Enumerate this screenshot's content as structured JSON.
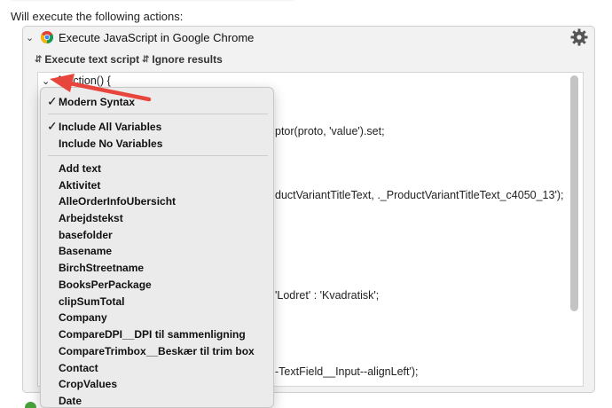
{
  "header": {
    "text": "Will execute the following actions:"
  },
  "action": {
    "title": "Execute JavaScript in Google Chrome",
    "options": [
      {
        "label": "Execute text script"
      },
      {
        "label": "Ignore results"
      }
    ]
  },
  "code": {
    "first_line": "function() {",
    "visible_fragments": [
      "ptor(proto, 'value').set;",
      "ductVariantTitleText, ._ProductVariantTitleText_c4050_13');",
      "'Lodret' : 'Kvadratisk';",
      "-TextField__Input--alignLeft');"
    ]
  },
  "menu": {
    "items": [
      {
        "label": "Modern Syntax",
        "checked": true
      },
      {
        "label": "Include All Variables",
        "checked": true
      },
      {
        "label": "Include No Variables",
        "checked": false
      },
      {
        "label": "Add text"
      },
      {
        "label": "Aktivitet"
      },
      {
        "label": "AlleOrderInfoUbersicht"
      },
      {
        "label": "Arbejdstekst"
      },
      {
        "label": "basefolder"
      },
      {
        "label": "Basename"
      },
      {
        "label": "BirchStreetname"
      },
      {
        "label": "BooksPerPackage"
      },
      {
        "label": "clipSumTotal"
      },
      {
        "label": "Company"
      },
      {
        "label": "CompareDPI__DPI til sammenligning"
      },
      {
        "label": "CompareTrimbox__Beskær til trim box"
      },
      {
        "label": "Contact"
      },
      {
        "label": "CropValues"
      },
      {
        "label": "Date"
      }
    ]
  },
  "colors": {
    "arrow": "#e8453c",
    "add_button": "#46a03a"
  }
}
